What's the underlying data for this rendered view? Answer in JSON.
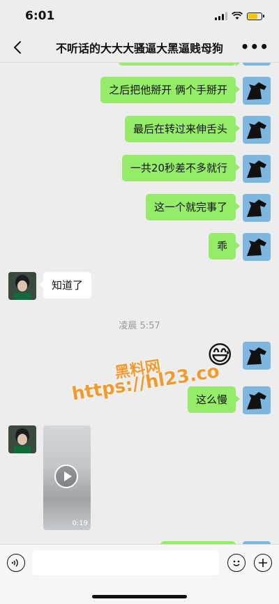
{
  "status": {
    "time": "6:01"
  },
  "nav": {
    "title": "不听话的大大大骚逼大黑逼贱母狗",
    "more": "•••"
  },
  "messages": [
    {
      "side": "right",
      "text": "之后把他掰开 俩个手掰开"
    },
    {
      "side": "right",
      "text": "最后在转过来伸舌头"
    },
    {
      "side": "right",
      "text": "一共20秒差不多就行"
    },
    {
      "side": "right",
      "text": "这一个就完事了"
    },
    {
      "side": "right",
      "text": "乖"
    },
    {
      "side": "left",
      "text": "知道了"
    },
    {
      "side": "right",
      "text": "这么慢"
    }
  ],
  "timestamp": "凌晨 5:57",
  "emoji_message": "😅",
  "video": {
    "duration": "0:19"
  },
  "watermark": {
    "line1": "黑料网",
    "line2": "https://hl23.co"
  },
  "icons": {
    "back": "chevron-left-icon",
    "voice": "voice-icon",
    "emoji": "smile-icon",
    "plus": "plus-icon"
  },
  "colors": {
    "bubble_self": "#95ec69",
    "bubble_other": "#ffffff",
    "background": "#ededed"
  }
}
